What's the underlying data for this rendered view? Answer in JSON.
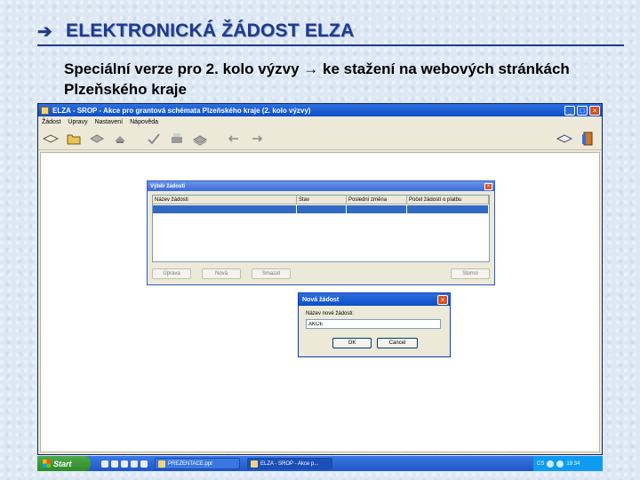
{
  "slide": {
    "bullet": "➔",
    "title": "ELEKTRONICKÁ ŽÁDOST ELZA",
    "subtitle": "Speciální verze pro 2. kolo výzvy → ke stažení na webových stránkách Plzeňského kraje"
  },
  "window": {
    "title": "ELZA - SROP - Akce pro grantová schémata Plzeňského kraje (2. kolo výzvy)",
    "minimize": "_",
    "maximize": "□",
    "close": "×",
    "menu": [
      "Žádost",
      "Úpravy",
      "Nastavení",
      "Nápověda"
    ]
  },
  "select_dialog": {
    "title": "Výběr žádosti",
    "close": "×",
    "columns": [
      "Název žádosti",
      "Stav",
      "Poslední změna",
      "Počet žádostí o platbu"
    ],
    "buttons": [
      "Úprava",
      "Nová",
      "Smazat",
      "Storno"
    ]
  },
  "new_dialog": {
    "title": "Nová žádost",
    "close": "×",
    "label": "Název nové žádosti:",
    "value": "AKCE",
    "ok": "OK",
    "cancel": "Cancel"
  },
  "taskbar": {
    "start": "Start",
    "tasks": [
      "PREZENTACE.ppt",
      "ELZA - SROP - Akce p..."
    ],
    "lang": "CS",
    "time": "19:34"
  },
  "colors": {
    "slide_title": "#1f3a8c",
    "selection": "#316ac5",
    "xp_title": "#0a4fc8"
  }
}
